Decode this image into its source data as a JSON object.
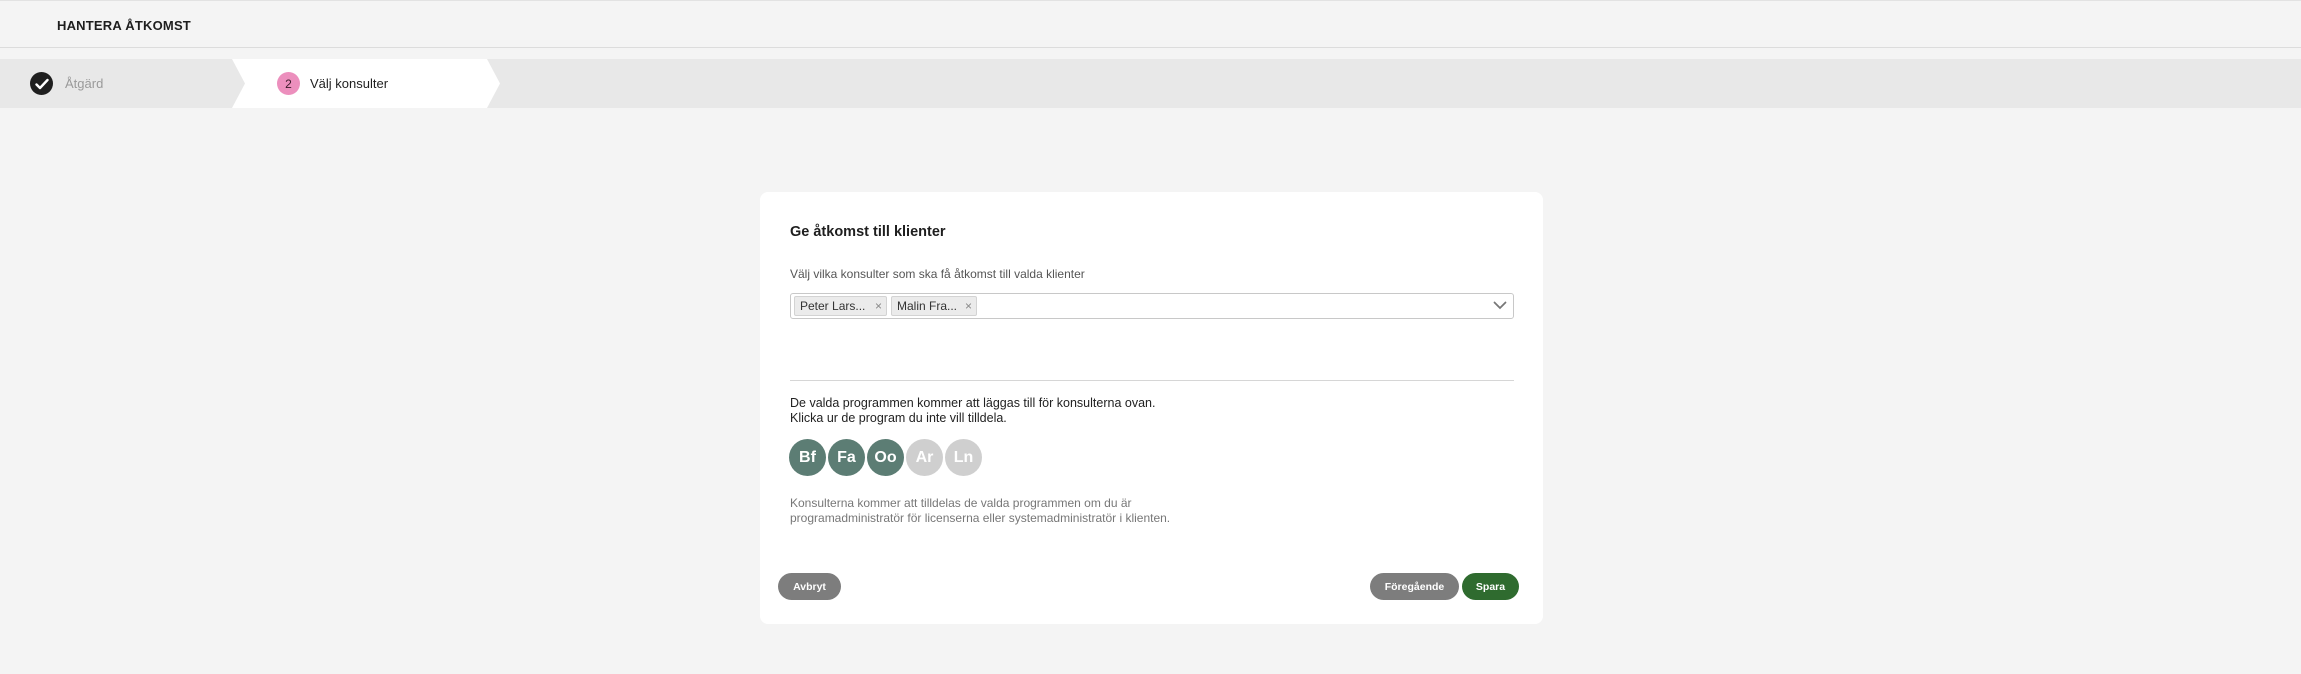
{
  "header": {
    "title": "HANTERA ÅTKOMST"
  },
  "steps": [
    {
      "number": "",
      "label": "Åtgärd",
      "status": "completed",
      "icon": "check-icon"
    },
    {
      "number": "2",
      "label": "Välj konsulter",
      "status": "active",
      "accent": "#ec8fbd"
    }
  ],
  "dialog": {
    "title": "Ge åtkomst till klienter",
    "select_label": "Välj vilka konsulter som ska få åtkomst till valda klienter",
    "selected_consultants": [
      "Peter Lars...",
      "Malin Fra..."
    ],
    "chip_remove": "×",
    "info_line1": "De valda programmen kommer att läggas till för konsulterna ovan.",
    "info_line2": "Klicka ur de program du inte vill tilldela.",
    "programs": [
      {
        "code": "Bf",
        "selected": true
      },
      {
        "code": "Fa",
        "selected": true
      },
      {
        "code": "Oo",
        "selected": true
      },
      {
        "code": "Ar",
        "selected": false
      },
      {
        "code": "Ln",
        "selected": false
      }
    ],
    "note": "Konsulterna kommer att tilldelas de valda programmen om du är programadministratör för licenserna eller systemadministratör i klienten.",
    "buttons": {
      "cancel": "Avbryt",
      "previous": "Föregående",
      "save": "Spara"
    }
  },
  "colors": {
    "program_selected": "#5c7d74",
    "program_unselected": "#cfcfcf",
    "button_grey": "#7d7d7d",
    "button_save": "#2f6b2f"
  }
}
